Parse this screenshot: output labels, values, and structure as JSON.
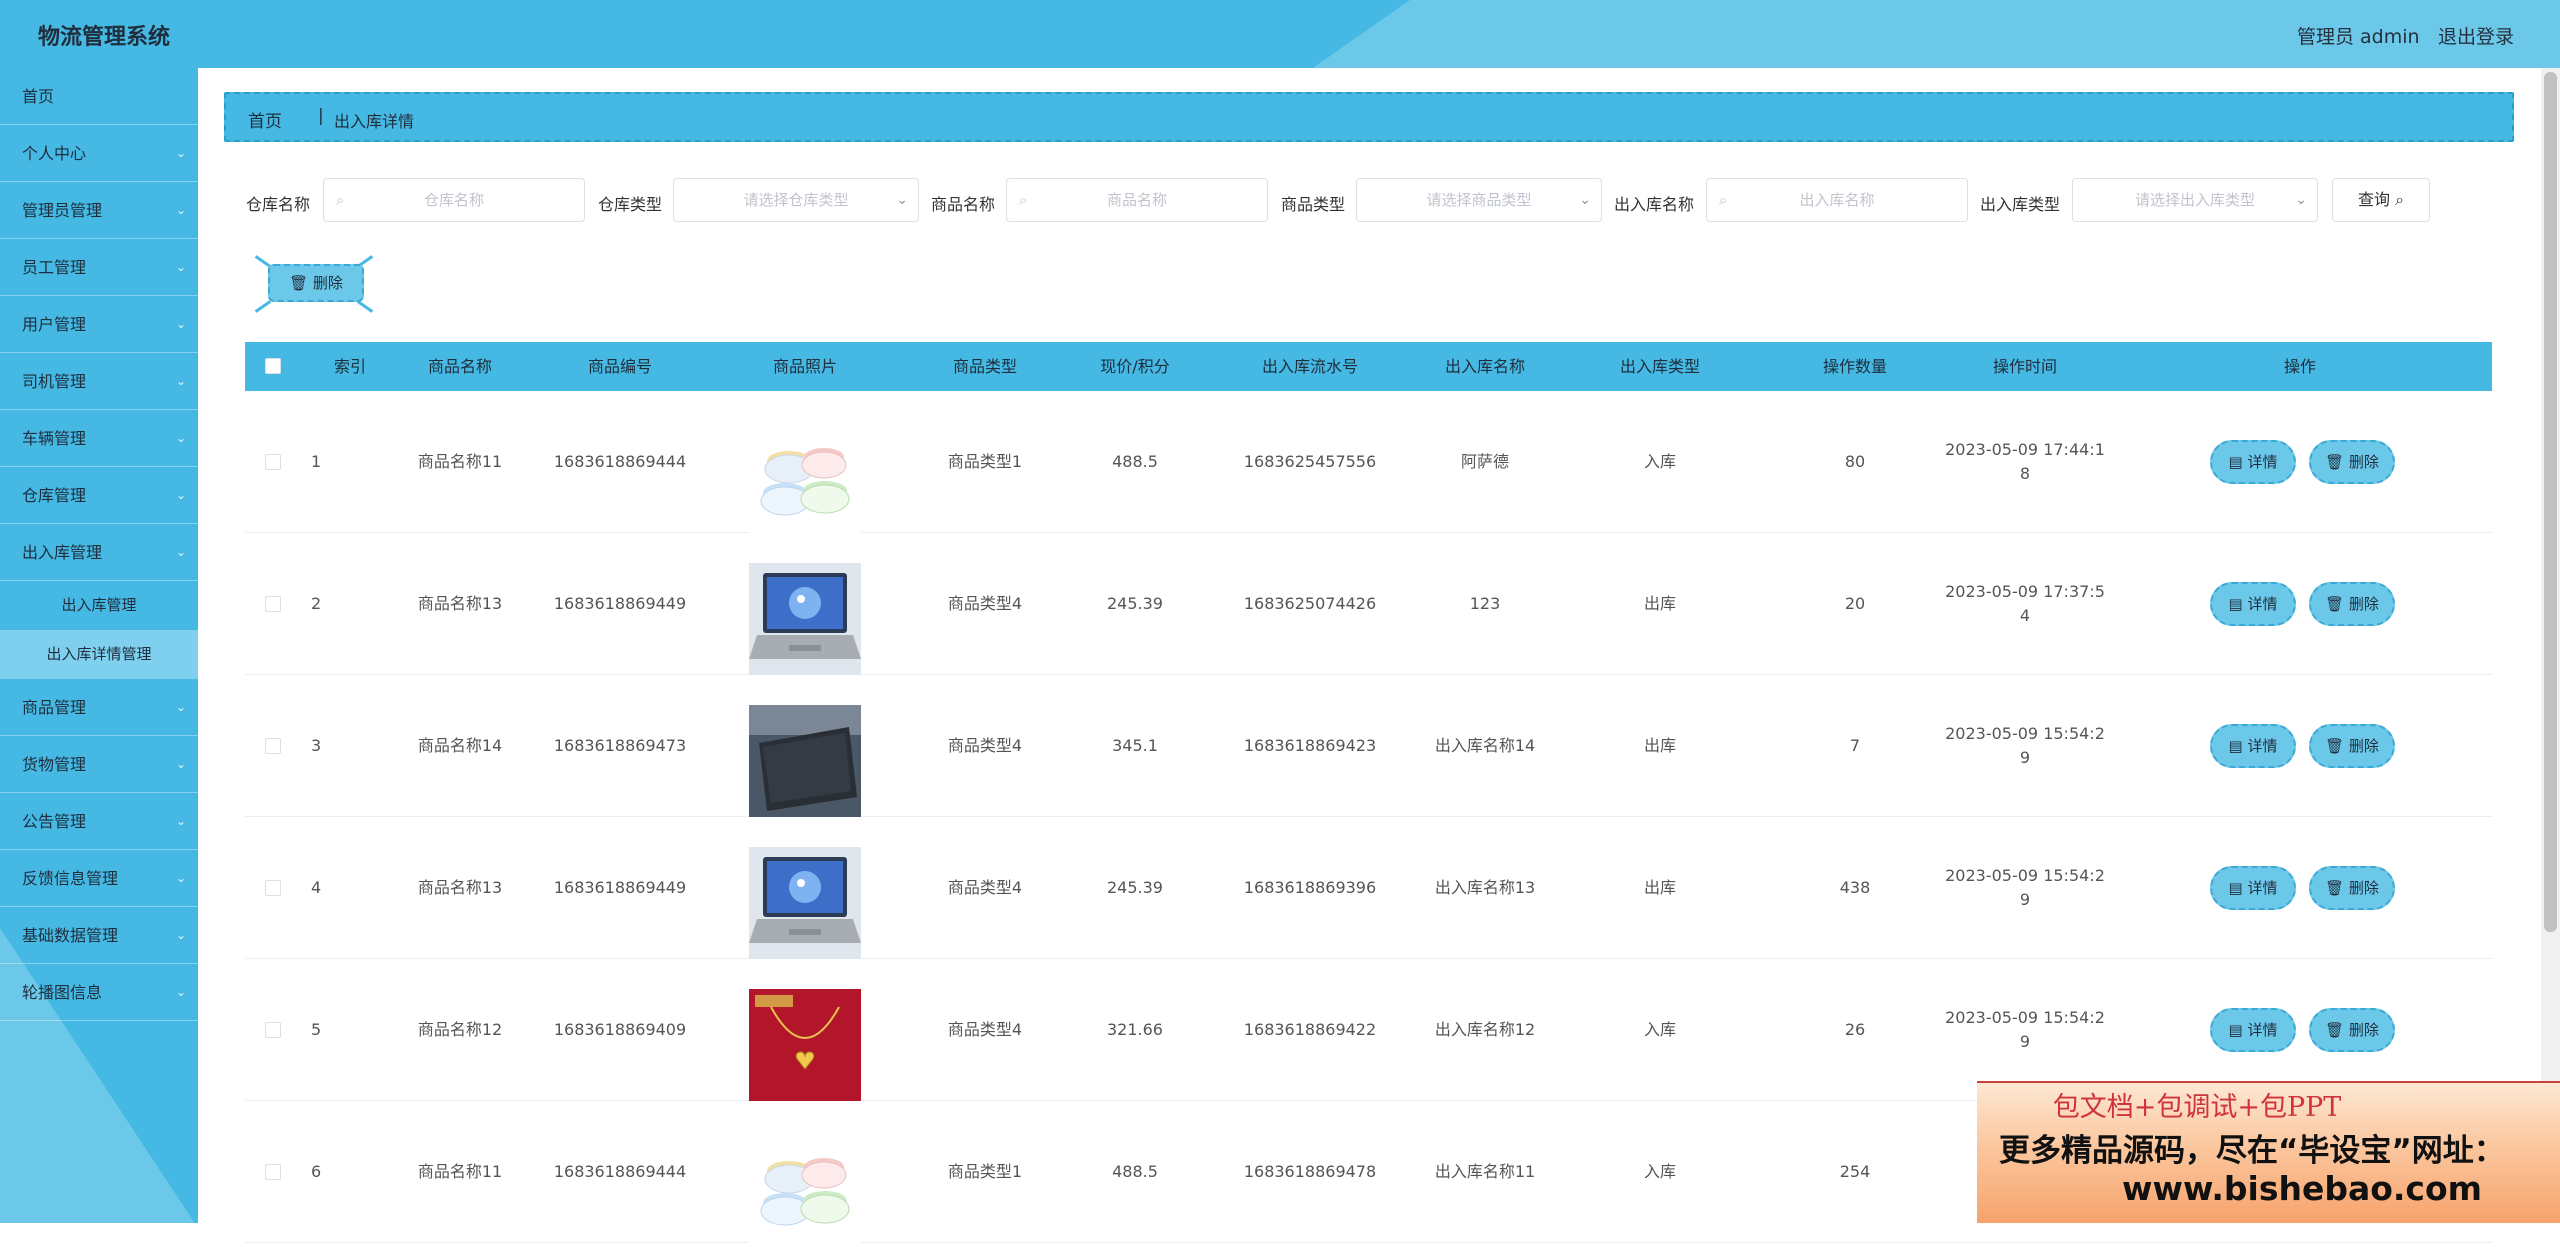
{
  "header": {
    "title": "物流管理系统",
    "admin": "管理员 admin",
    "logout": "退出登录"
  },
  "sidebar": {
    "items": [
      {
        "label": "首页",
        "chevron": false
      },
      {
        "label": "个人中心",
        "chevron": true
      },
      {
        "label": "管理员管理",
        "chevron": true
      },
      {
        "label": "员工管理",
        "chevron": true
      },
      {
        "label": "用户管理",
        "chevron": true
      },
      {
        "label": "司机管理",
        "chevron": true
      },
      {
        "label": "车辆管理",
        "chevron": true
      },
      {
        "label": "仓库管理",
        "chevron": true
      },
      {
        "label": "出入库管理",
        "chevron": true,
        "expanded": true
      }
    ],
    "sub_items": [
      {
        "label": "出入库管理",
        "active": false
      },
      {
        "label": "出入库详情管理",
        "active": true
      }
    ],
    "items_after": [
      {
        "label": "商品管理"
      },
      {
        "label": "货物管理"
      },
      {
        "label": "公告管理"
      },
      {
        "label": "反馈信息管理"
      },
      {
        "label": "基础数据管理"
      },
      {
        "label": "轮播图信息"
      }
    ]
  },
  "breadcrumb": {
    "home": "首页",
    "separator": "|",
    "current": "出入库详情"
  },
  "search": {
    "warehouse_name_label": "仓库名称",
    "warehouse_name_placeholder": "仓库名称",
    "warehouse_type_label": "仓库类型",
    "warehouse_type_placeholder": "请选择仓库类型",
    "goods_name_label": "商品名称",
    "goods_name_placeholder": "商品名称",
    "goods_type_label": "商品类型",
    "goods_type_placeholder": "请选择商品类型",
    "io_name_label": "出入库名称",
    "io_name_placeholder": "出入库名称",
    "io_type_label": "出入库类型",
    "io_type_placeholder": "请选择出入库类型",
    "query": "查询"
  },
  "batch_delete": "删除",
  "table": {
    "columns": [
      "索引",
      "商品名称",
      "商品编号",
      "商品照片",
      "商品类型",
      "现价/积分",
      "出入库流水号",
      "出入库名称",
      "出入库类型",
      "操作数量",
      "操作时间",
      "操作"
    ],
    "detail_label": "详情",
    "delete_label": "删除",
    "rows": [
      {
        "index": "1",
        "name": "商品名称11",
        "code": "1683618869444",
        "photo": "bowls",
        "type": "商品类型1",
        "price": "488.5",
        "serial": "1683625457556",
        "io_name": "阿萨德",
        "io_type": "入库",
        "qty": "80",
        "time1": "2023-05-09 17:44:1",
        "time2": "8"
      },
      {
        "index": "2",
        "name": "商品名称13",
        "code": "1683618869449",
        "photo": "laptop",
        "type": "商品类型4",
        "price": "245.39",
        "serial": "1683625074426",
        "io_name": "123",
        "io_type": "出库",
        "qty": "20",
        "time1": "2023-05-09 17:37:5",
        "time2": "4"
      },
      {
        "index": "3",
        "name": "商品名称14",
        "code": "1683618869473",
        "photo": "laptop-dark",
        "type": "商品类型4",
        "price": "345.1",
        "serial": "1683618869423",
        "io_name": "出入库名称14",
        "io_type": "出库",
        "qty": "7",
        "time1": "2023-05-09 15:54:2",
        "time2": "9"
      },
      {
        "index": "4",
        "name": "商品名称13",
        "code": "1683618869449",
        "photo": "laptop",
        "type": "商品类型4",
        "price": "245.39",
        "serial": "1683618869396",
        "io_name": "出入库名称13",
        "io_type": "出库",
        "qty": "438",
        "time1": "2023-05-09 15:54:2",
        "time2": "9"
      },
      {
        "index": "5",
        "name": "商品名称12",
        "code": "1683618869409",
        "photo": "necklace",
        "type": "商品类型4",
        "price": "321.66",
        "serial": "1683618869422",
        "io_name": "出入库名称12",
        "io_type": "入库",
        "qty": "26",
        "time1": "2023-05-09 15:54:2",
        "time2": "9"
      },
      {
        "index": "6",
        "name": "商品名称11",
        "code": "1683618869444",
        "photo": "bowls",
        "type": "商品类型1",
        "price": "488.5",
        "serial": "1683618869478",
        "io_name": "出入库名称11",
        "io_type": "入库",
        "qty": "254",
        "time1": "",
        "time2": ""
      }
    ]
  },
  "watermark": {
    "line1": "包文档+包调试+包PPT",
    "line2": "更多精品源码，尽在“毕设宝”网址：",
    "line3": "www.bishebao.com"
  },
  "colors": {
    "primary": "#45b9e3",
    "primary_light": "#6cc8e9",
    "active_submenu": "#7fd0ee"
  }
}
